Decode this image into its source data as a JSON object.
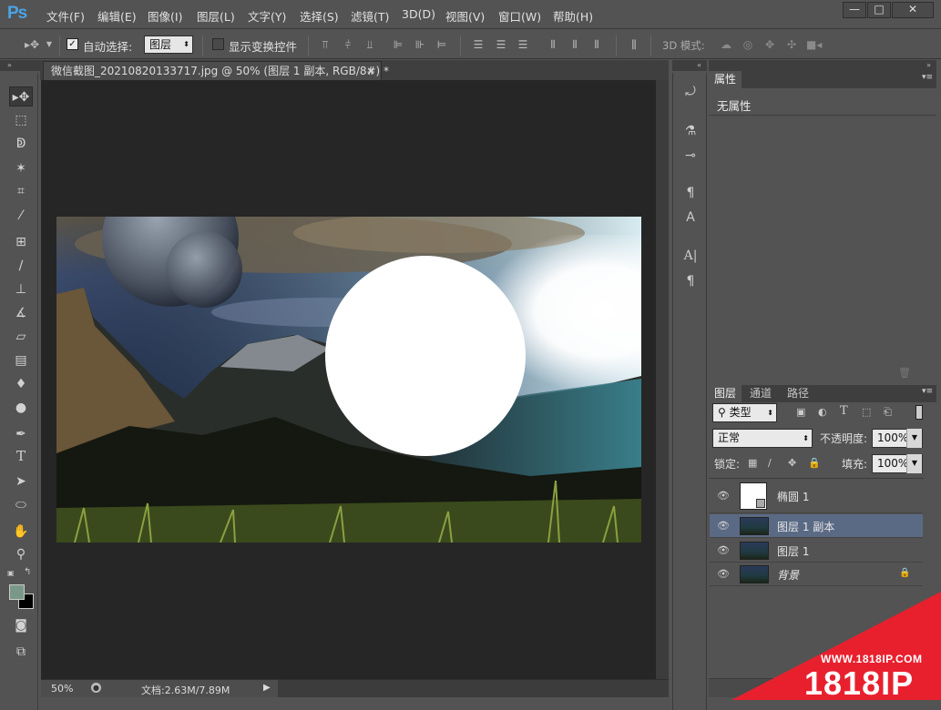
{
  "app": {
    "logo": "Ps"
  },
  "menu": [
    {
      "label": "文件(F)"
    },
    {
      "label": "编辑(E)"
    },
    {
      "label": "图像(I)"
    },
    {
      "label": "图层(L)"
    },
    {
      "label": "文字(Y)"
    },
    {
      "label": "选择(S)"
    },
    {
      "label": "滤镜(T)"
    },
    {
      "label": "3D(D)"
    },
    {
      "label": "视图(V)"
    },
    {
      "label": "窗口(W)"
    },
    {
      "label": "帮助(H)"
    }
  ],
  "window_controls": {
    "minimize": "—",
    "maximize": "□",
    "close": "✕"
  },
  "options": {
    "auto_select_label": "自动选择:",
    "auto_select_checked": true,
    "auto_select_target": "图层",
    "show_transform_label": "显示变换控件",
    "mode_3d_label": "3D 模式:"
  },
  "document": {
    "tab_title": "微信截图_20210820133717.jpg @ 50% (图层 1 副本, RGB/8#) *",
    "close_symbol": "×"
  },
  "status": {
    "zoom": "50%",
    "doc_info": "文档:2.63M/7.89M"
  },
  "properties": {
    "tab": "属性",
    "content": "无属性"
  },
  "layers": {
    "tabs": [
      "图层",
      "通道",
      "路径"
    ],
    "filter_kind": "类型",
    "blend_mode": "正常",
    "opacity_label": "不透明度:",
    "opacity": "100%",
    "lock_label": "锁定:",
    "fill_label": "填充:",
    "fill": "100%",
    "items": [
      {
        "name": "椭圆 1",
        "selected": false,
        "type": "shape"
      },
      {
        "name": "图层 1 副本",
        "selected": true,
        "type": "image"
      },
      {
        "name": "图层 1",
        "selected": false,
        "type": "image"
      },
      {
        "name": "背景",
        "selected": false,
        "type": "background",
        "locked": true
      }
    ]
  },
  "watermark": {
    "url": "WWW.1818IP.COM",
    "brand": "1818IP"
  },
  "colors": {
    "accent": "#4aa3e8",
    "selected_layer": "#5a6a84",
    "watermark_red": "#e8202e",
    "foreground_swatch": "#7a9888",
    "background_swatch": "#000000"
  }
}
